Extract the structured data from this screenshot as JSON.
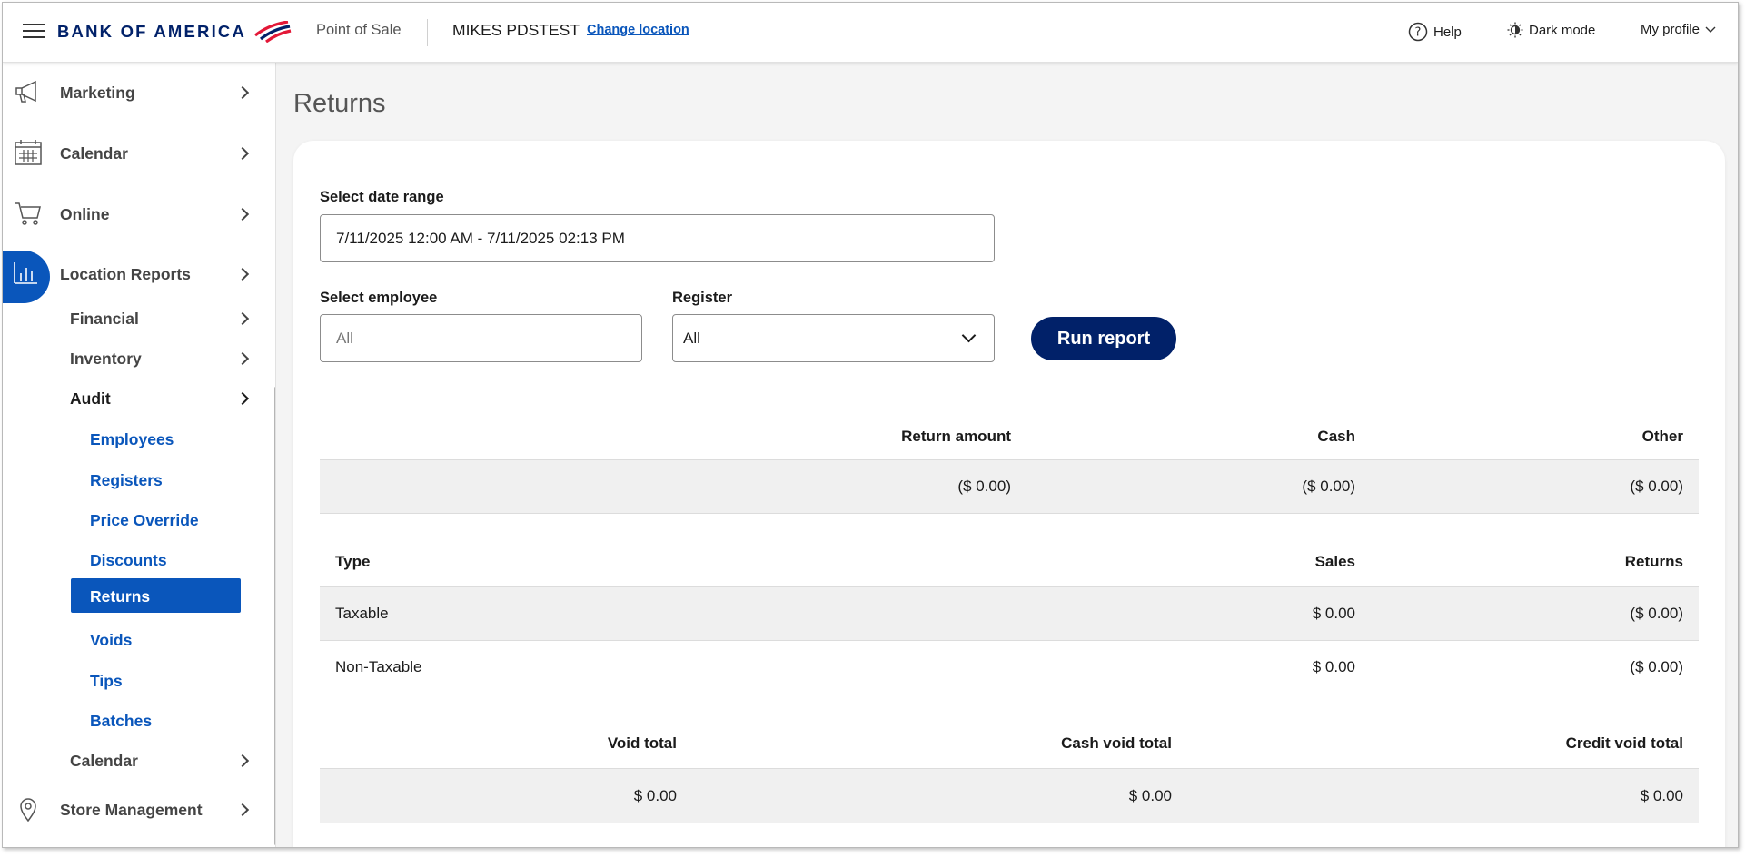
{
  "header": {
    "logo_text": "BANK OF AMERICA",
    "app_name": "Point of Sale",
    "store_name": "MIKES PDSTEST",
    "change_location": "Change location",
    "help": "Help",
    "dark_mode": "Dark mode",
    "my_profile": "My profile"
  },
  "sidebar": {
    "marketing": "Marketing",
    "calendar": "Calendar",
    "online": "Online",
    "location_reports": "Location Reports",
    "financial": "Financial",
    "inventory": "Inventory",
    "audit": "Audit",
    "audit_items": [
      "Employees",
      "Registers",
      "Price Override",
      "Discounts",
      "Returns",
      "Voids",
      "Tips",
      "Batches"
    ],
    "calendar_sub": "Calendar",
    "store_management": "Store Management"
  },
  "page": {
    "title": "Returns"
  },
  "form": {
    "date_range_label": "Select date range",
    "date_range_value": "7/11/2025 12:00 AM - 7/11/2025 02:13 PM",
    "employee_label": "Select employee",
    "employee_placeholder": "All",
    "register_label": "Register",
    "register_value": "All",
    "run_report": "Run report"
  },
  "summary_table": {
    "headers": [
      "Return amount",
      "Cash",
      "Other"
    ],
    "values": [
      "($ 0.00)",
      "($ 0.00)",
      "($ 0.00)"
    ]
  },
  "type_table": {
    "headers": [
      "Type",
      "Sales",
      "Returns"
    ],
    "rows": [
      [
        "Taxable",
        "$ 0.00",
        "($ 0.00)"
      ],
      [
        "Non-Taxable",
        "$ 0.00",
        "($ 0.00)"
      ]
    ]
  },
  "void_table": {
    "headers": [
      "Void total",
      "Cash void total",
      "Credit void total"
    ],
    "values": [
      "$ 0.00",
      "$ 0.00",
      "$ 0.00"
    ]
  },
  "colors": {
    "brand_navy": "#012169",
    "brand_red": "#e31837",
    "link_blue": "#0a56bb"
  }
}
